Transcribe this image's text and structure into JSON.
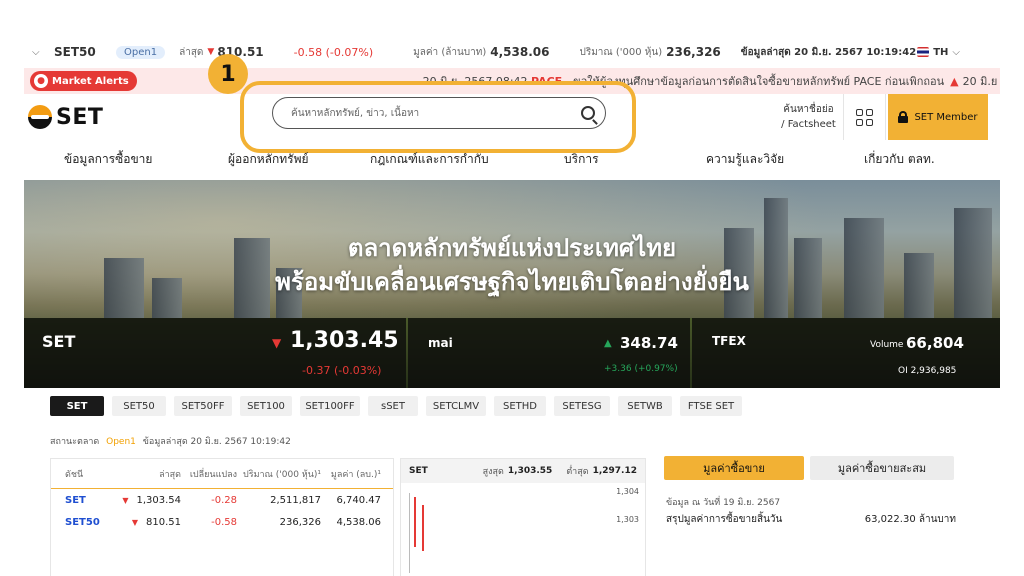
{
  "ticker": {
    "index": "SET50",
    "status": "Open1",
    "last_label": "ล่าสุด",
    "last_value": "810.51",
    "change": "-0.58 (-0.07%)",
    "value_label": "มูลค่า (ล้านบาท)",
    "value_amount": "4,538.06",
    "volume_label": "ปริมาณ ('000 หุ้น)",
    "volume_amount": "236,326",
    "updated": "ข้อมูลล่าสุด 20 มิ.ย. 2567 10:19:42",
    "language": "TH"
  },
  "alerts": {
    "label": "Market Alerts",
    "message_prefix": "20 มิ.ย. 2567 08:42",
    "message_pace": "PACE",
    "message_rest": "- ขอให้ผู้ลงทุนศึกษาข้อมูลก่อนการตัดสินใจซื้อขายหลักทรัพย์ PACE ก่อนเพิกถอน",
    "message_tail": "20 มิ.ย"
  },
  "header": {
    "logo_text": "SET",
    "search_placeholder": "ค้นหาหลักทรัพย์, ข่าว, เนื้อหา",
    "step_number": "1",
    "factsheet_line1": "ค้นหาชื่อย่อ",
    "factsheet_line2": "/ Factsheet",
    "member_label": "SET Member"
  },
  "nav": [
    "ข้อมูลการซื้อขาย",
    "ผู้ออกหลักทรัพย์",
    "กฎเกณฑ์และการกำกับ",
    "บริการ",
    "ความรู้และวิจัย",
    "เกี่ยวกับ ตลท."
  ],
  "hero": {
    "line1": "ตลาดหลักทรัพย์แห่งประเทศไทย",
    "line2": "พร้อมขับเคลื่อนเศรษฐกิจไทยเติบโตอย่างยั่งยืน",
    "set": {
      "name": "SET",
      "value": "1,303.45",
      "change": "-0.37 (-0.03%)"
    },
    "mai": {
      "name": "mai",
      "value": "348.74",
      "change": "+3.36 (+0.97%)"
    },
    "tfex": {
      "name": "TFEX",
      "volume_label": "Volume",
      "volume": "66,804",
      "oi": "OI 2,936,985"
    }
  },
  "tabs": [
    "SET",
    "SET50",
    "SET50FF",
    "SET100",
    "SET100FF",
    "sSET",
    "SETCLMV",
    "SETHD",
    "SETESG",
    "SETWB",
    "FTSE SET"
  ],
  "status": {
    "label": "สถานะตลาด",
    "state": "Open1",
    "updated": "ข้อมูลล่าสุด 20 มิ.ย. 2567 10:19:42"
  },
  "table": {
    "headers": [
      "ดัชนี",
      "ล่าสุด",
      "เปลี่ยนแปลง",
      "ปริมาณ ('000 หุ้น)¹",
      "มูลค่า (ลบ.)¹"
    ],
    "rows": [
      {
        "name": "SET",
        "last": "1,303.54",
        "change": "-0.28",
        "volume": "2,511,817",
        "value": "6,740.47"
      },
      {
        "name": "SET50",
        "last": "810.51",
        "change": "-0.58",
        "volume": "236,326",
        "value": "4,538.06"
      }
    ]
  },
  "mini_chart": {
    "name": "SET",
    "high_label": "สูงสุด",
    "high": "1,303.55",
    "low_label": "ต่ำสุด",
    "low": "1,297.12",
    "y_top": "1,304",
    "y_mid": "1,303"
  },
  "trading": {
    "value_tab": "มูลค่าซื้อขาย",
    "accumulated_tab": "มูลค่าซื้อขายสะสม",
    "as_of": "ข้อมูล ณ วันที่ 19 มิ.ย. 2567",
    "summary_label": "สรุปมูลค่าการซื้อขายสิ้นวัน",
    "summary_value": "63,022.30 ล้านบาท"
  },
  "colors": {
    "accent": "#f2b134",
    "negative": "#e53935",
    "positive": "#26a65b",
    "link": "#1f4fd1"
  }
}
